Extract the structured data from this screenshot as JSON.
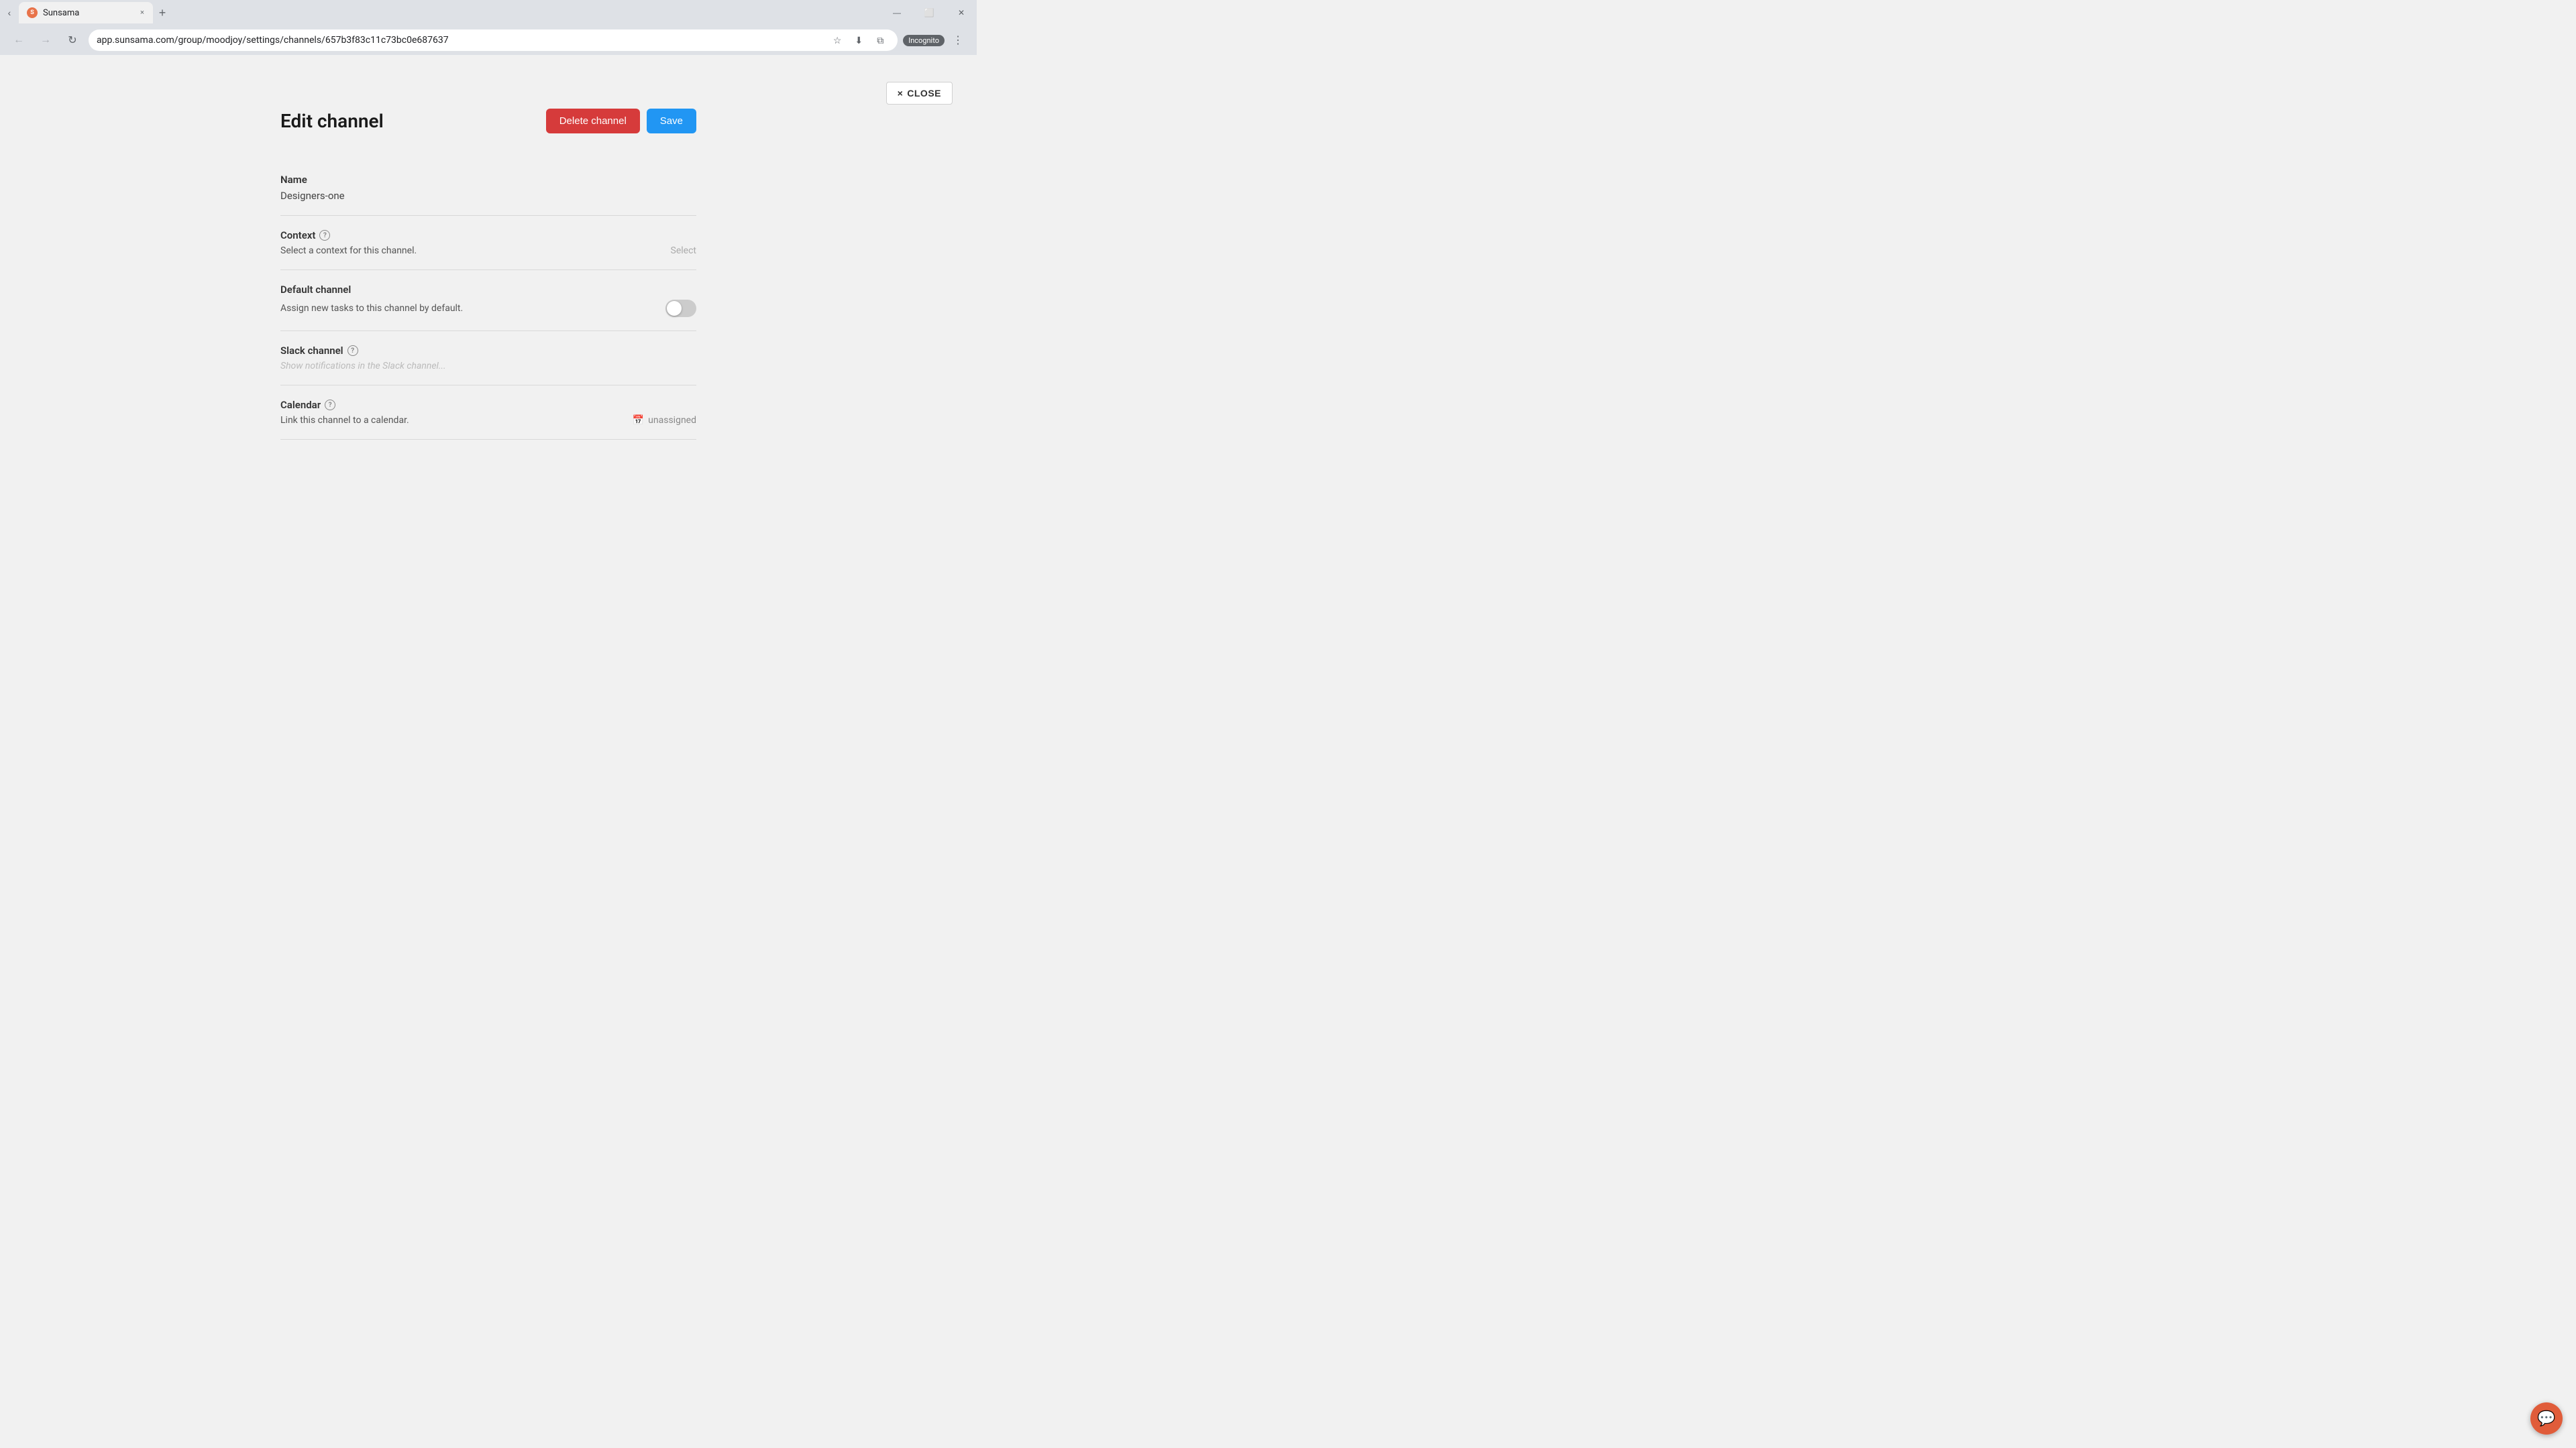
{
  "browser": {
    "tab": {
      "favicon_letter": "S",
      "title": "Sunsama",
      "close_label": "×"
    },
    "new_tab_label": "+",
    "window_controls": {
      "minimize": "—",
      "maximize": "⬜",
      "close": "✕"
    },
    "nav": {
      "back": "←",
      "forward": "→",
      "refresh": "↻"
    },
    "url": "app.sunsama.com/group/moodjoy/settings/channels/657b3f83c11c73bc0e687637",
    "url_actions": {
      "bookmark": "☆",
      "download": "⬇",
      "extension": "⧉"
    },
    "incognito_label": "Incognito",
    "menu_dots": "⋮"
  },
  "page": {
    "close_button": {
      "icon": "×",
      "label": "CLOSE"
    },
    "form": {
      "title": "Edit channel",
      "delete_button": "Delete channel",
      "save_button": "Save",
      "fields": {
        "name": {
          "label": "Name",
          "value": "Designers-one"
        },
        "context": {
          "label": "Context",
          "help": "?",
          "description": "Select a context for this channel.",
          "action": "Select"
        },
        "default_channel": {
          "label": "Default channel",
          "description": "Assign new tasks to this channel by default.",
          "toggle_state": false
        },
        "slack_channel": {
          "label": "Slack channel",
          "help": "?",
          "placeholder": "Show notifications in the Slack channel..."
        },
        "calendar": {
          "label": "Calendar",
          "help": "?",
          "description": "Link this channel to a calendar.",
          "calendar_icon": "📅",
          "value": "unassigned"
        }
      }
    },
    "chat_widget": {
      "icon": "💬"
    }
  }
}
